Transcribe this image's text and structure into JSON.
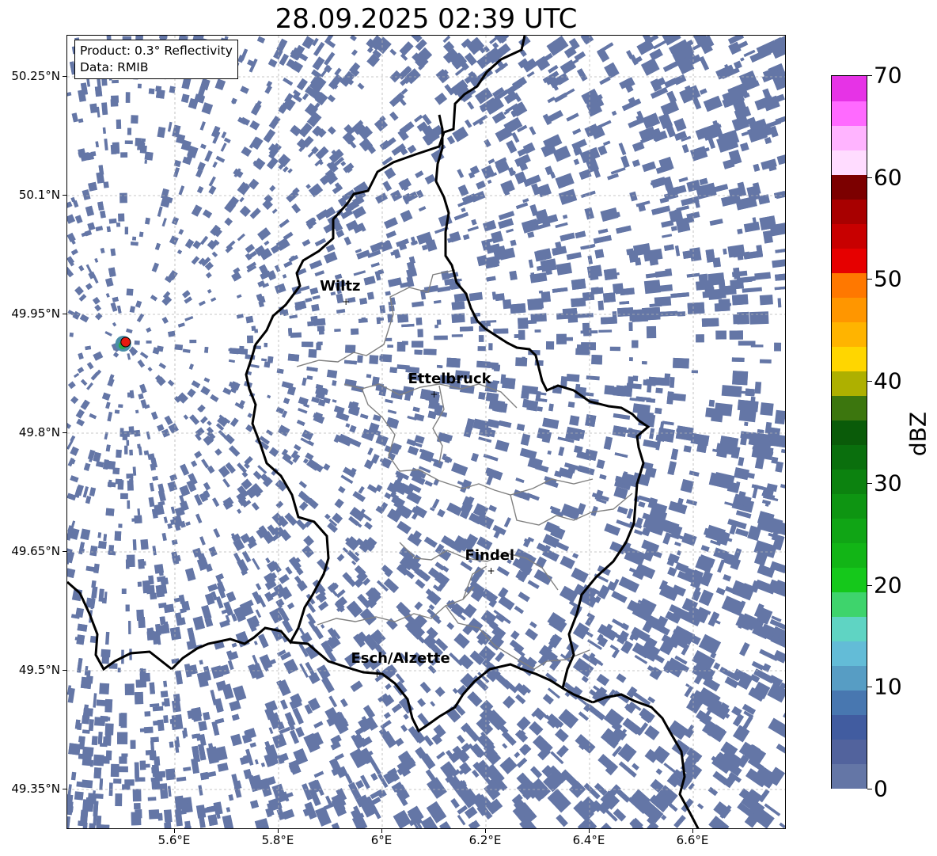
{
  "title": "28.09.2025 02:39 UTC",
  "info_box": {
    "product": "Product: 0.3° Reflectivity",
    "data": "Data: RMIB"
  },
  "axes": {
    "lon_range": [
      5.4,
      6.8
    ],
    "lat_range": [
      49.3,
      50.3
    ],
    "x_ticks": [
      {
        "value": 5.6,
        "label": "5.6°E"
      },
      {
        "value": 5.8,
        "label": "5.8°E"
      },
      {
        "value": 6.0,
        "label": "6°E"
      },
      {
        "value": 6.2,
        "label": "6.2°E"
      },
      {
        "value": 6.4,
        "label": "6.4°E"
      },
      {
        "value": 6.6,
        "label": "6.6°E"
      }
    ],
    "y_ticks": [
      {
        "value": 50.25,
        "label": "50.25°N"
      },
      {
        "value": 50.1,
        "label": "50.1°N"
      },
      {
        "value": 49.95,
        "label": "49.95°N"
      },
      {
        "value": 49.8,
        "label": "49.8°N"
      },
      {
        "value": 49.65,
        "label": "49.65°N"
      },
      {
        "value": 49.5,
        "label": "49.5°N"
      },
      {
        "value": 49.35,
        "label": "49.35°N"
      }
    ]
  },
  "cities": [
    {
      "name": "Wiltz",
      "lon": 5.93,
      "lat": 49.967
    },
    {
      "name": "Ettelbruck",
      "lon": 6.1,
      "lat": 49.85
    },
    {
      "name": "Findel",
      "lon": 6.21,
      "lat": 49.627
    },
    {
      "name": "Esch/Alzette",
      "lon": 5.99,
      "lat": 49.497
    }
  ],
  "radar_site": {
    "lon": 5.505,
    "lat": 49.915
  },
  "echo_color": "#6476a6",
  "colorbar": {
    "label": "dBZ",
    "min": 0,
    "max": 70,
    "ticks": [
      {
        "value": 0,
        "label": "0"
      },
      {
        "value": 10,
        "label": "10"
      },
      {
        "value": 20,
        "label": "20"
      },
      {
        "value": 30,
        "label": "30"
      },
      {
        "value": 40,
        "label": "40"
      },
      {
        "value": 50,
        "label": "50"
      },
      {
        "value": 60,
        "label": "60"
      },
      {
        "value": 70,
        "label": "70"
      }
    ],
    "colors": [
      "#6476a6",
      "#52639d",
      "#415ca0",
      "#4877b0",
      "#579dc4",
      "#63bcd7",
      "#5fd4c3",
      "#3ed46c",
      "#15c81b",
      "#12b516",
      "#10a515",
      "#0e9512",
      "#0c820f",
      "#0a6f0d",
      "#0a5b09",
      "#3c760e",
      "#aeb000",
      "#ffd600",
      "#ffb400",
      "#ff9600",
      "#ff7800",
      "#e60000",
      "#c80000",
      "#a80000",
      "#7c0000",
      "#ffdcff",
      "#ffb4ff",
      "#ff6aff",
      "#e633e6"
    ]
  }
}
